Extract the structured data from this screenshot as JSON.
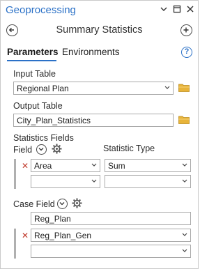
{
  "pane": {
    "title": "Geoprocessing",
    "tool_title": "Summary Statistics"
  },
  "tabs": [
    {
      "label": "Parameters",
      "active": true
    },
    {
      "label": "Environments",
      "active": false
    }
  ],
  "input_table": {
    "label": "Input Table",
    "value": "Regional Plan"
  },
  "output_table": {
    "label": "Output Table",
    "value": "City_Plan_Statistics"
  },
  "statistics_fields": {
    "label": "Statistics Fields",
    "field_header": "Field",
    "type_header": "Statistic Type",
    "rows": [
      {
        "field": "Area",
        "type": "Sum"
      },
      {
        "field": "",
        "type": ""
      }
    ]
  },
  "case_field": {
    "label": "Case Field",
    "rows": [
      {
        "value": "Reg_Plan"
      },
      {
        "value": "Reg_Plan_Gen"
      },
      {
        "value": ""
      }
    ]
  },
  "colors": {
    "accent": "#2b71c7",
    "remove": "#c0392b",
    "folder": "#e8b43a"
  }
}
